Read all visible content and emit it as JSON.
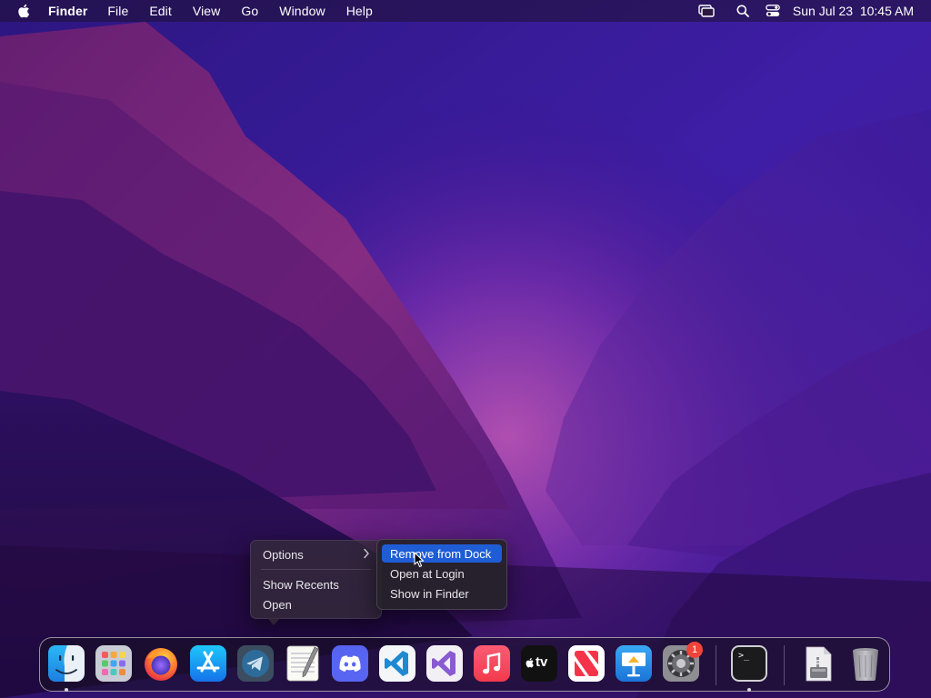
{
  "menubar": {
    "app_name": "Finder",
    "menus": [
      "File",
      "Edit",
      "View",
      "Go",
      "Window",
      "Help"
    ],
    "status_icons": [
      "screen-mirroring-icon",
      "search-icon",
      "control-center-icon"
    ],
    "clock": "Sun Jul 23  10:45 AM"
  },
  "context_menu": {
    "items": {
      "options": "Options",
      "show_recents": "Show Recents",
      "open": "Open"
    },
    "submenu": {
      "remove_from_dock": "Remove from Dock",
      "open_at_login": "Open at Login",
      "show_in_finder": "Show in Finder",
      "highlighted": "Remove from Dock"
    }
  },
  "dock": {
    "apps": [
      {
        "name": "Finder",
        "icon": "finder-icon",
        "running": true
      },
      {
        "name": "Launchpad",
        "icon": "launchpad-icon",
        "running": false
      },
      {
        "name": "Firefox",
        "icon": "firefox-icon",
        "running": false
      },
      {
        "name": "App Store",
        "icon": "app-store-icon",
        "running": false
      },
      {
        "name": "Telegram",
        "icon": "telegram-icon",
        "running": false
      },
      {
        "name": "TextEdit",
        "icon": "textedit-icon",
        "running": false
      },
      {
        "name": "Discord",
        "icon": "discord-icon",
        "running": false
      },
      {
        "name": "Visual Studio Code",
        "icon": "vscode-icon",
        "running": false
      },
      {
        "name": "Visual Studio",
        "icon": "visual-studio-icon",
        "running": false
      },
      {
        "name": "Music",
        "icon": "music-icon",
        "running": false
      },
      {
        "name": "TV",
        "icon": "apple-tv-icon",
        "running": false
      },
      {
        "name": "News",
        "icon": "news-icon",
        "running": false
      },
      {
        "name": "Keynote",
        "icon": "keynote-icon",
        "running": false
      },
      {
        "name": "System Settings",
        "icon": "system-settings-icon",
        "running": false,
        "badge": "1"
      },
      {
        "name": "Terminal",
        "icon": "terminal-icon",
        "running": true
      },
      {
        "name": "Archive",
        "icon": "archive-utility-icon",
        "running": false
      },
      {
        "name": "Trash",
        "icon": "trash-icon",
        "running": false
      }
    ],
    "tv_label": "tv",
    "terminal_prompt": ">_"
  },
  "colors": {
    "menu_highlight": "#1f5dd6",
    "badge": "#f0443a"
  }
}
